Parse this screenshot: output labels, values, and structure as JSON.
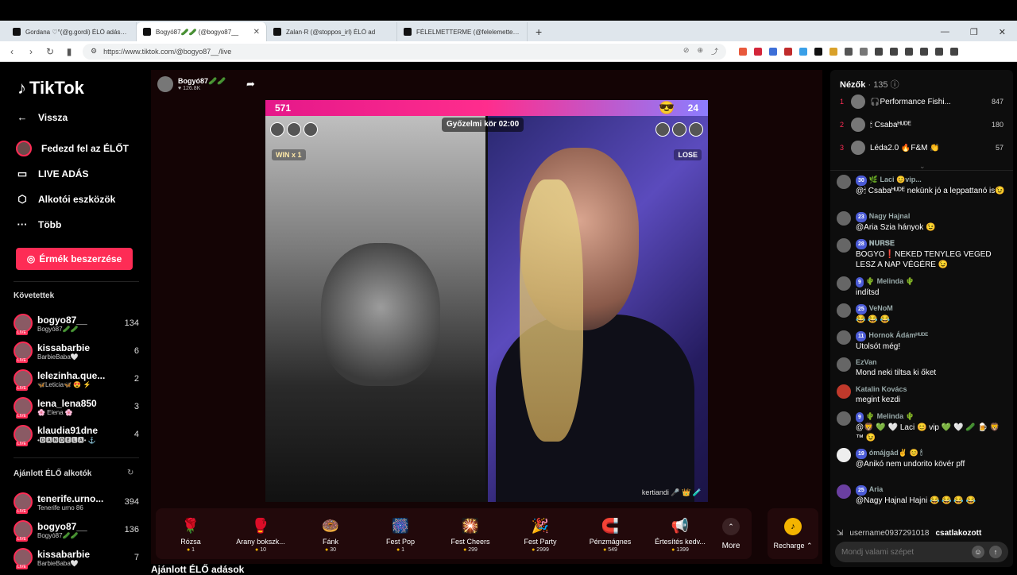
{
  "browser": {
    "tabs": [
      {
        "title": "Gordana ♡°(@g.gordi) ÉLŐ adásban",
        "active": false
      },
      {
        "title": "Bogyó87🥒🥒 (@bogyo87__",
        "active": true
      },
      {
        "title": "Zalan·R (@stoppos_irl) ÉLŐ ad",
        "active": false
      },
      {
        "title": "FÉLELMETTERME (@felelemetterme) É",
        "active": false
      }
    ],
    "new_tab": "+",
    "url": "https://www.tiktok.com/@bogyo87__/live"
  },
  "sidebar": {
    "brand": "TikTok",
    "back": "Vissza",
    "nav": [
      {
        "icon": "live-avatar-icon",
        "label": "Fedezd fel az ÉLŐT"
      },
      {
        "icon": "camera-icon",
        "label": "LIVE ADÁS"
      },
      {
        "icon": "creator-tools-icon",
        "label": "Alkotói eszközök"
      },
      {
        "icon": "more-dots-icon",
        "label": "Több"
      }
    ],
    "coins_button": "Érmék beszerzése",
    "following_title": "Követettek",
    "following": [
      {
        "name": "bogyo87__",
        "sub": "Bogyó87🥒🥒",
        "count": "134"
      },
      {
        "name": "kissabarbie",
        "sub": "BarbieBaba🤍",
        "count": "6"
      },
      {
        "name": "lelezinha.que...",
        "sub": "🦋Leticia🦋 😍 ⚡",
        "count": "2"
      },
      {
        "name": "lena_lena850",
        "sub": "🌸 Elena 🌸",
        "count": "3"
      },
      {
        "name": "klaudia91dne",
        "sub": "•🅳🅰🅽🅾🅴🅻🅰• ⚓",
        "count": "4"
      }
    ],
    "recommended_title": "Ajánlott ÉLŐ alkotók",
    "recommended": [
      {
        "name": "tenerife.urno...",
        "sub": "Tenerife urno 86",
        "count": "394"
      },
      {
        "name": "bogyo87__",
        "sub": "Bogyó87🥒🥒",
        "count": "136"
      },
      {
        "name": "kissabarbie",
        "sub": "BarbieBaba🤍",
        "count": "7"
      }
    ]
  },
  "stream": {
    "host_name": "Bogyó87🥒🥒",
    "host_likes": "126.8K",
    "score_left": "571",
    "score_right": "24",
    "timer": "Győzelmi kör 02:00",
    "wins": "WIN x 1",
    "lose": "LOSE",
    "right_label": "kertiandi 🎤 👑 🧪"
  },
  "gifts": [
    {
      "name": "Rózsa",
      "price": "1",
      "icon": "🌹"
    },
    {
      "name": "Arany bokszk...",
      "price": "10",
      "icon": "🥊"
    },
    {
      "name": "Fánk",
      "price": "30",
      "icon": "🍩"
    },
    {
      "name": "Fest Pop",
      "price": "1",
      "icon": "🎆"
    },
    {
      "name": "Fest Cheers",
      "price": "299",
      "icon": "🎇"
    },
    {
      "name": "Fest Party",
      "price": "2999",
      "icon": "🎉"
    },
    {
      "name": "Pénzmágnes",
      "price": "549",
      "icon": "🧲"
    },
    {
      "name": "Értesítés kedv...",
      "price": "1399",
      "icon": "📢"
    }
  ],
  "more_label": "More",
  "recharge_label": "Recharge ⌃",
  "below_title": "Ajánlott ÉLŐ adások",
  "chat": {
    "viewers_label": "Nézők",
    "viewers_count": "· 135",
    "ranking": [
      {
        "pos": "1",
        "name": "🎧Performance Fishi...",
        "score": "847"
      },
      {
        "pos": "2",
        "name": "🕯 Csabaᴴᵁᴰᴱ",
        "score": "180"
      },
      {
        "pos": "3",
        "name": "Léda2.0 🔥F&M 👏",
        "score": "57"
      }
    ],
    "messages": [
      {
        "level": "30",
        "name": "🌿 Laci 😊vip...",
        "text": "@🕯 Csabaᴴᵁᴰᴱ nekünk jó a leppattanó is😉"
      },
      {
        "level": "23",
        "name": "Nagy Hajnal",
        "text": "@Aria  Szia hányok 😉"
      },
      {
        "level": "28",
        "name": "𝐍𝐔𝐑𝐒𝐄",
        "text": "BOGYO❗NEKED TENYLEG VEGED LESZ A NAP VÉGÉRE 😉"
      },
      {
        "level": "9",
        "name": "🌵 Melinda 🌵",
        "text": "indítsd"
      },
      {
        "level": "25",
        "name": "VeNoM",
        "text": "😂 😂 😂"
      },
      {
        "level": "11",
        "name": "Hornok Ádámᴴᵁᴰᴱ",
        "text": "Utolsót még!"
      },
      {
        "level": "",
        "name": "EzVan",
        "text": "Mond neki tiltsa ki őket"
      },
      {
        "level": "",
        "name": "Katalin Kovács",
        "text": "megint kezdi"
      },
      {
        "level": "9",
        "name": "🌵 Melinda 🌵",
        "text": "@🦁 💚 🤍 Laci 😊 vip 💚 🤍 🥒 🍺 🦁 ™ 😉"
      },
      {
        "level": "19",
        "name": "ómájgád✌ 😊 🕯",
        "text": "@Anikó nem  undorito kövér pff"
      },
      {
        "level": "25",
        "name": "Aria",
        "text": "@Nagy Hajnal Hajni 😂 😂 😂 😂"
      }
    ],
    "joined_user": "username0937291018",
    "joined_text": "csatlakozott",
    "input_placeholder": "Mondj valami szépet"
  }
}
